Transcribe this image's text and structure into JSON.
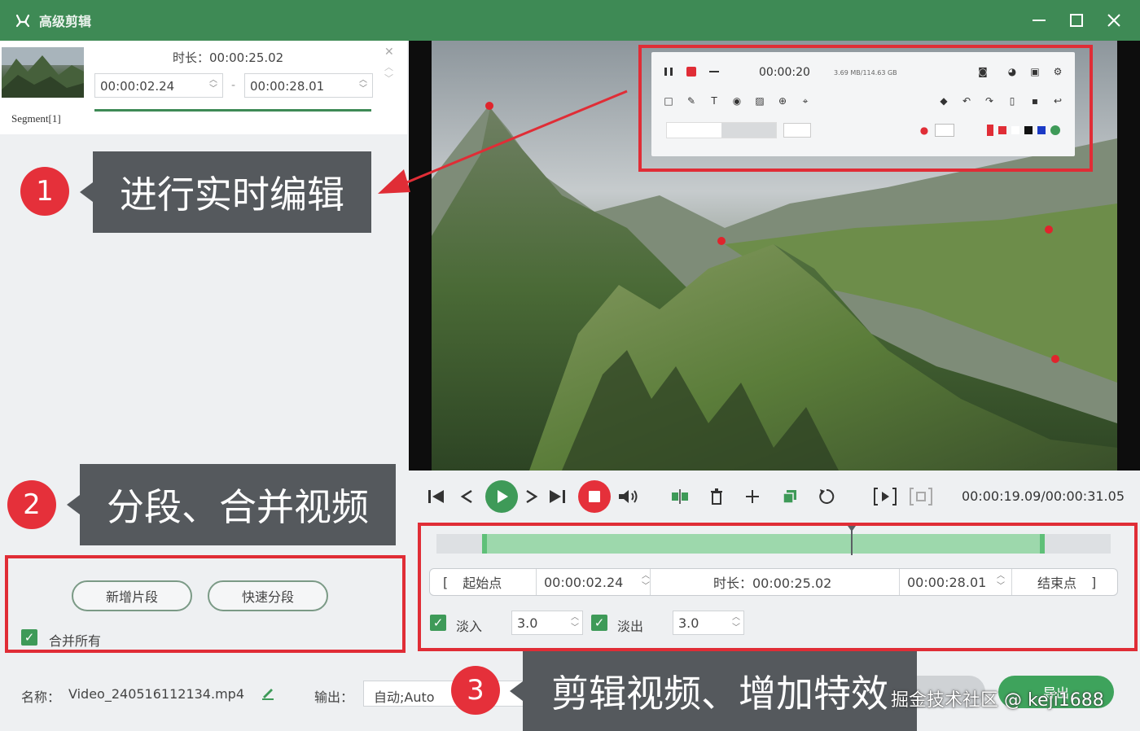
{
  "app": {
    "title": "高级剪辑"
  },
  "segment": {
    "label": "Segment[1]",
    "duration": "时长：00:00:25.02",
    "start": "00:00:02.24",
    "end": "00:00:28.01"
  },
  "callouts": [
    {
      "number": "1",
      "text": "进行实时编辑"
    },
    {
      "number": "2",
      "text": "分段、合并视频"
    },
    {
      "number": "3",
      "text": "剪辑视频、增加特效"
    }
  ],
  "segment_actions": {
    "add_segment": "新增片段",
    "quick_split": "快速分段",
    "merge_all": "合并所有"
  },
  "floating_toolbar": {
    "time": "00:00:20",
    "size": "3.69 MB/114.63 GB"
  },
  "player": {
    "time": "00:00:19.09/00:00:31.05"
  },
  "timeline": {
    "selection_start": 0.07,
    "selection_end": 0.9,
    "playhead": 0.615
  },
  "trim": {
    "start_label": "起始点",
    "start_value": "00:00:02.24",
    "duration": "时长：00:00:25.02",
    "end_value": "00:00:28.01",
    "end_label": "结束点"
  },
  "fade": {
    "in_label": "淡入",
    "in_value": "3.0",
    "out_label": "淡出",
    "out_value": "3.0"
  },
  "footer": {
    "name_label": "名称：",
    "name_value": "Video_240516112134.mp4",
    "output_label": "输出：",
    "output_value": "自动;Auto",
    "export_label": "导出"
  },
  "watermark": "掘金技术社区 @ keji1688",
  "colors": {
    "accent": "#3e8a55",
    "highlight": "#e02d36",
    "callout": "#55595d"
  }
}
